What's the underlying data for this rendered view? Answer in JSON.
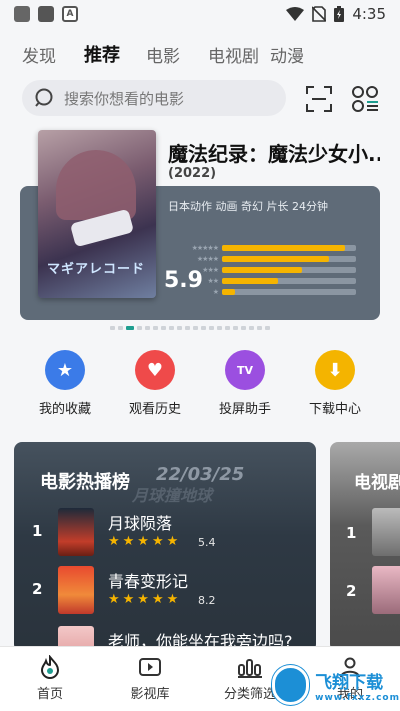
{
  "status_bar": {
    "time": "4:35"
  },
  "tabs": [
    {
      "label": "发现",
      "active": false
    },
    {
      "label": "推荐",
      "active": true
    },
    {
      "label": "电影",
      "active": false
    },
    {
      "label": "电视剧",
      "active": false
    },
    {
      "label": "动漫",
      "active": false
    }
  ],
  "search": {
    "placeholder": "搜索你想看的电影"
  },
  "featured": {
    "title": "魔法纪录：魔法少女小..",
    "year": "(2022)",
    "meta": "日本动作 动画 奇幻 片长 24分钟",
    "score": "5.9",
    "poster_text": "マギアレコード",
    "rating_distribution": [
      0.92,
      0.8,
      0.6,
      0.42,
      0.1
    ]
  },
  "carousel": {
    "total": 20,
    "active_index": 2
  },
  "actions": [
    {
      "label": "我的收藏",
      "icon": "star-icon",
      "color": "#3b7be8"
    },
    {
      "label": "观看历史",
      "icon": "heart-icon",
      "color": "#ef4a4a"
    },
    {
      "label": "投屏助手",
      "icon": "tv-icon",
      "color": "#9b4fe0",
      "icon_text": "TV"
    },
    {
      "label": "下载中心",
      "icon": "download-icon",
      "color": "#f4b400"
    }
  ],
  "movie_hot": {
    "title": "电影热播榜",
    "bg_date": "22/03/25",
    "bg_text": "月球撞地球",
    "items": [
      {
        "rank": "1",
        "name": "月球陨落",
        "score": "5.4",
        "stars": "★★★★★"
      },
      {
        "rank": "2",
        "name": "青春变形记",
        "score": "8.2",
        "stars": "★★★★★"
      },
      {
        "rank": "3",
        "name": "老师，你能坐在我旁边吗?",
        "score": "",
        "stars": ""
      }
    ]
  },
  "tv_hot": {
    "title": "电视剧",
    "ranks": [
      "1",
      "2"
    ]
  },
  "bottom_nav": [
    {
      "label": "首页",
      "icon": "home-flame-icon",
      "active": true
    },
    {
      "label": "影视库",
      "icon": "video-library-icon",
      "active": false
    },
    {
      "label": "分类筛选",
      "icon": "category-filter-icon",
      "active": false
    },
    {
      "label": "我的",
      "icon": "profile-icon",
      "active": false
    }
  ],
  "watermark": {
    "name": "飞翔下载",
    "url": "www.fxxz.com"
  }
}
